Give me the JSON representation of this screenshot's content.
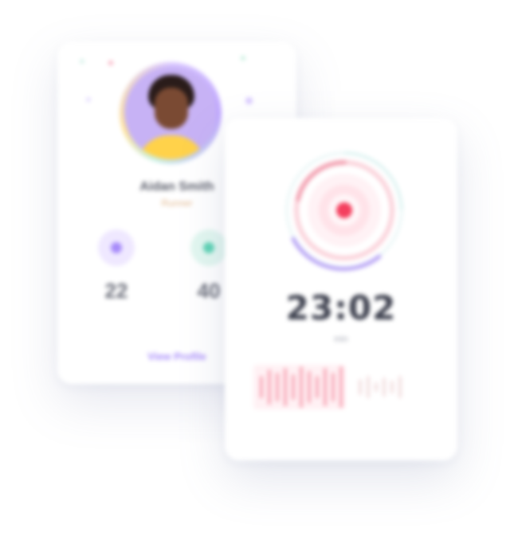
{
  "profile": {
    "name": "Aidan Smith",
    "role": "Runner",
    "stats": [
      {
        "value": "22",
        "icon": "star-icon",
        "color": "#a78bfa"
      },
      {
        "value": "40",
        "icon": "heart-icon",
        "color": "#5fd3b5"
      }
    ],
    "link_label": "View Profile"
  },
  "recorder": {
    "timer": "23:02",
    "unit": "min"
  },
  "colors": {
    "accent_purple": "#a78bfa",
    "accent_teal": "#5fd3b5",
    "accent_red": "#f43f5e"
  }
}
